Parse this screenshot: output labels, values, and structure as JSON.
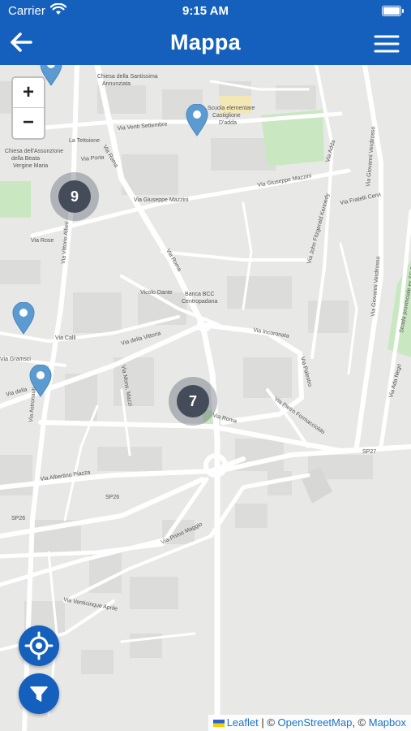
{
  "status_bar": {
    "carrier": "Carrier",
    "time": "9:15 AM"
  },
  "nav": {
    "title": "Mappa"
  },
  "zoom": {
    "in": "+",
    "out": "−"
  },
  "clusters": [
    {
      "count": "9"
    },
    {
      "count": "7"
    }
  ],
  "street_labels": {
    "chiesa_ss": "Chiesa della Santissima",
    "annunziata": "Annunziata",
    "scuola1": "Scuola elementare",
    "scuola2": "Castiglione",
    "scuola3": "D'adda",
    "via_venti": "Via Venti Settembre",
    "tettoia": "La Tettoione",
    "chiesa_ass1": "Chiesa dell'Assunzione",
    "chiesa_ass2": "della Beata",
    "chiesa_ass3": "Vergine Maria",
    "via_roma_top": "Via Roma",
    "via_porta": "Via Porta",
    "via_mazzini_a": "Via Giuseppe Mazzini",
    "via_mazzini_b": "Via Giuseppe Mazzini",
    "via_fratelli": "Via Fratelli Cervi",
    "via_adda": "Via Adda",
    "via_giovanni_top": "Via Giovanni Verdirosso",
    "strada_prov": "Strada provinciale ex SS 591 Cremasca",
    "via_rose": "Via Rose",
    "via_vittorio": "Via Vittorio Alfieri",
    "via_roma_mid": "Via Roma",
    "via_kennedy": "Via John Fitzgerald Kennedy",
    "via_giovanni_mid": "Via Giovanni Verdirosso",
    "vicolo_dante": "Vicolo Dante",
    "banca1": "Banca BCC",
    "banca2": "Centropadana",
    "via_calli": "Via Calli",
    "via_gramsci": "Via Gramsci",
    "via_vittoria": "Via della Vittoria",
    "via_incoronata": "Via Incoronata",
    "via_palestro": "Via Palestro",
    "via_ada_negri": "Via Ada Negri",
    "via_della": "Via della",
    "via_astronauti": "Via Astronauti",
    "via_mons": "Via Mons. Mazzi",
    "via_pietro": "Via Pietro Formaccioldo",
    "via_roma_low": "Via Roma",
    "sp27": "SP27",
    "via_albertino": "Via Albertino Piazza",
    "sp26a": "SP26",
    "sp26b": "SP26",
    "via_primo": "Via Primo Maggio",
    "via_venticinque": "Via Venticinque Aprile"
  },
  "attribution": {
    "leaflet": "Leaflet",
    "sep": " | © ",
    "osm": "OpenStreetMap",
    "comma": ", © ",
    "mapbox": "Mapbox"
  },
  "icons": [
    "wifi-icon",
    "battery-icon",
    "back-arrow-icon",
    "hamburger-menu-icon",
    "map-pin-icon",
    "locate-icon",
    "filter-icon"
  ],
  "colors": {
    "brand": "#1560bd",
    "pin": "#5b9bd1",
    "cluster": "#444c5a",
    "park": "#c9e8c1"
  }
}
